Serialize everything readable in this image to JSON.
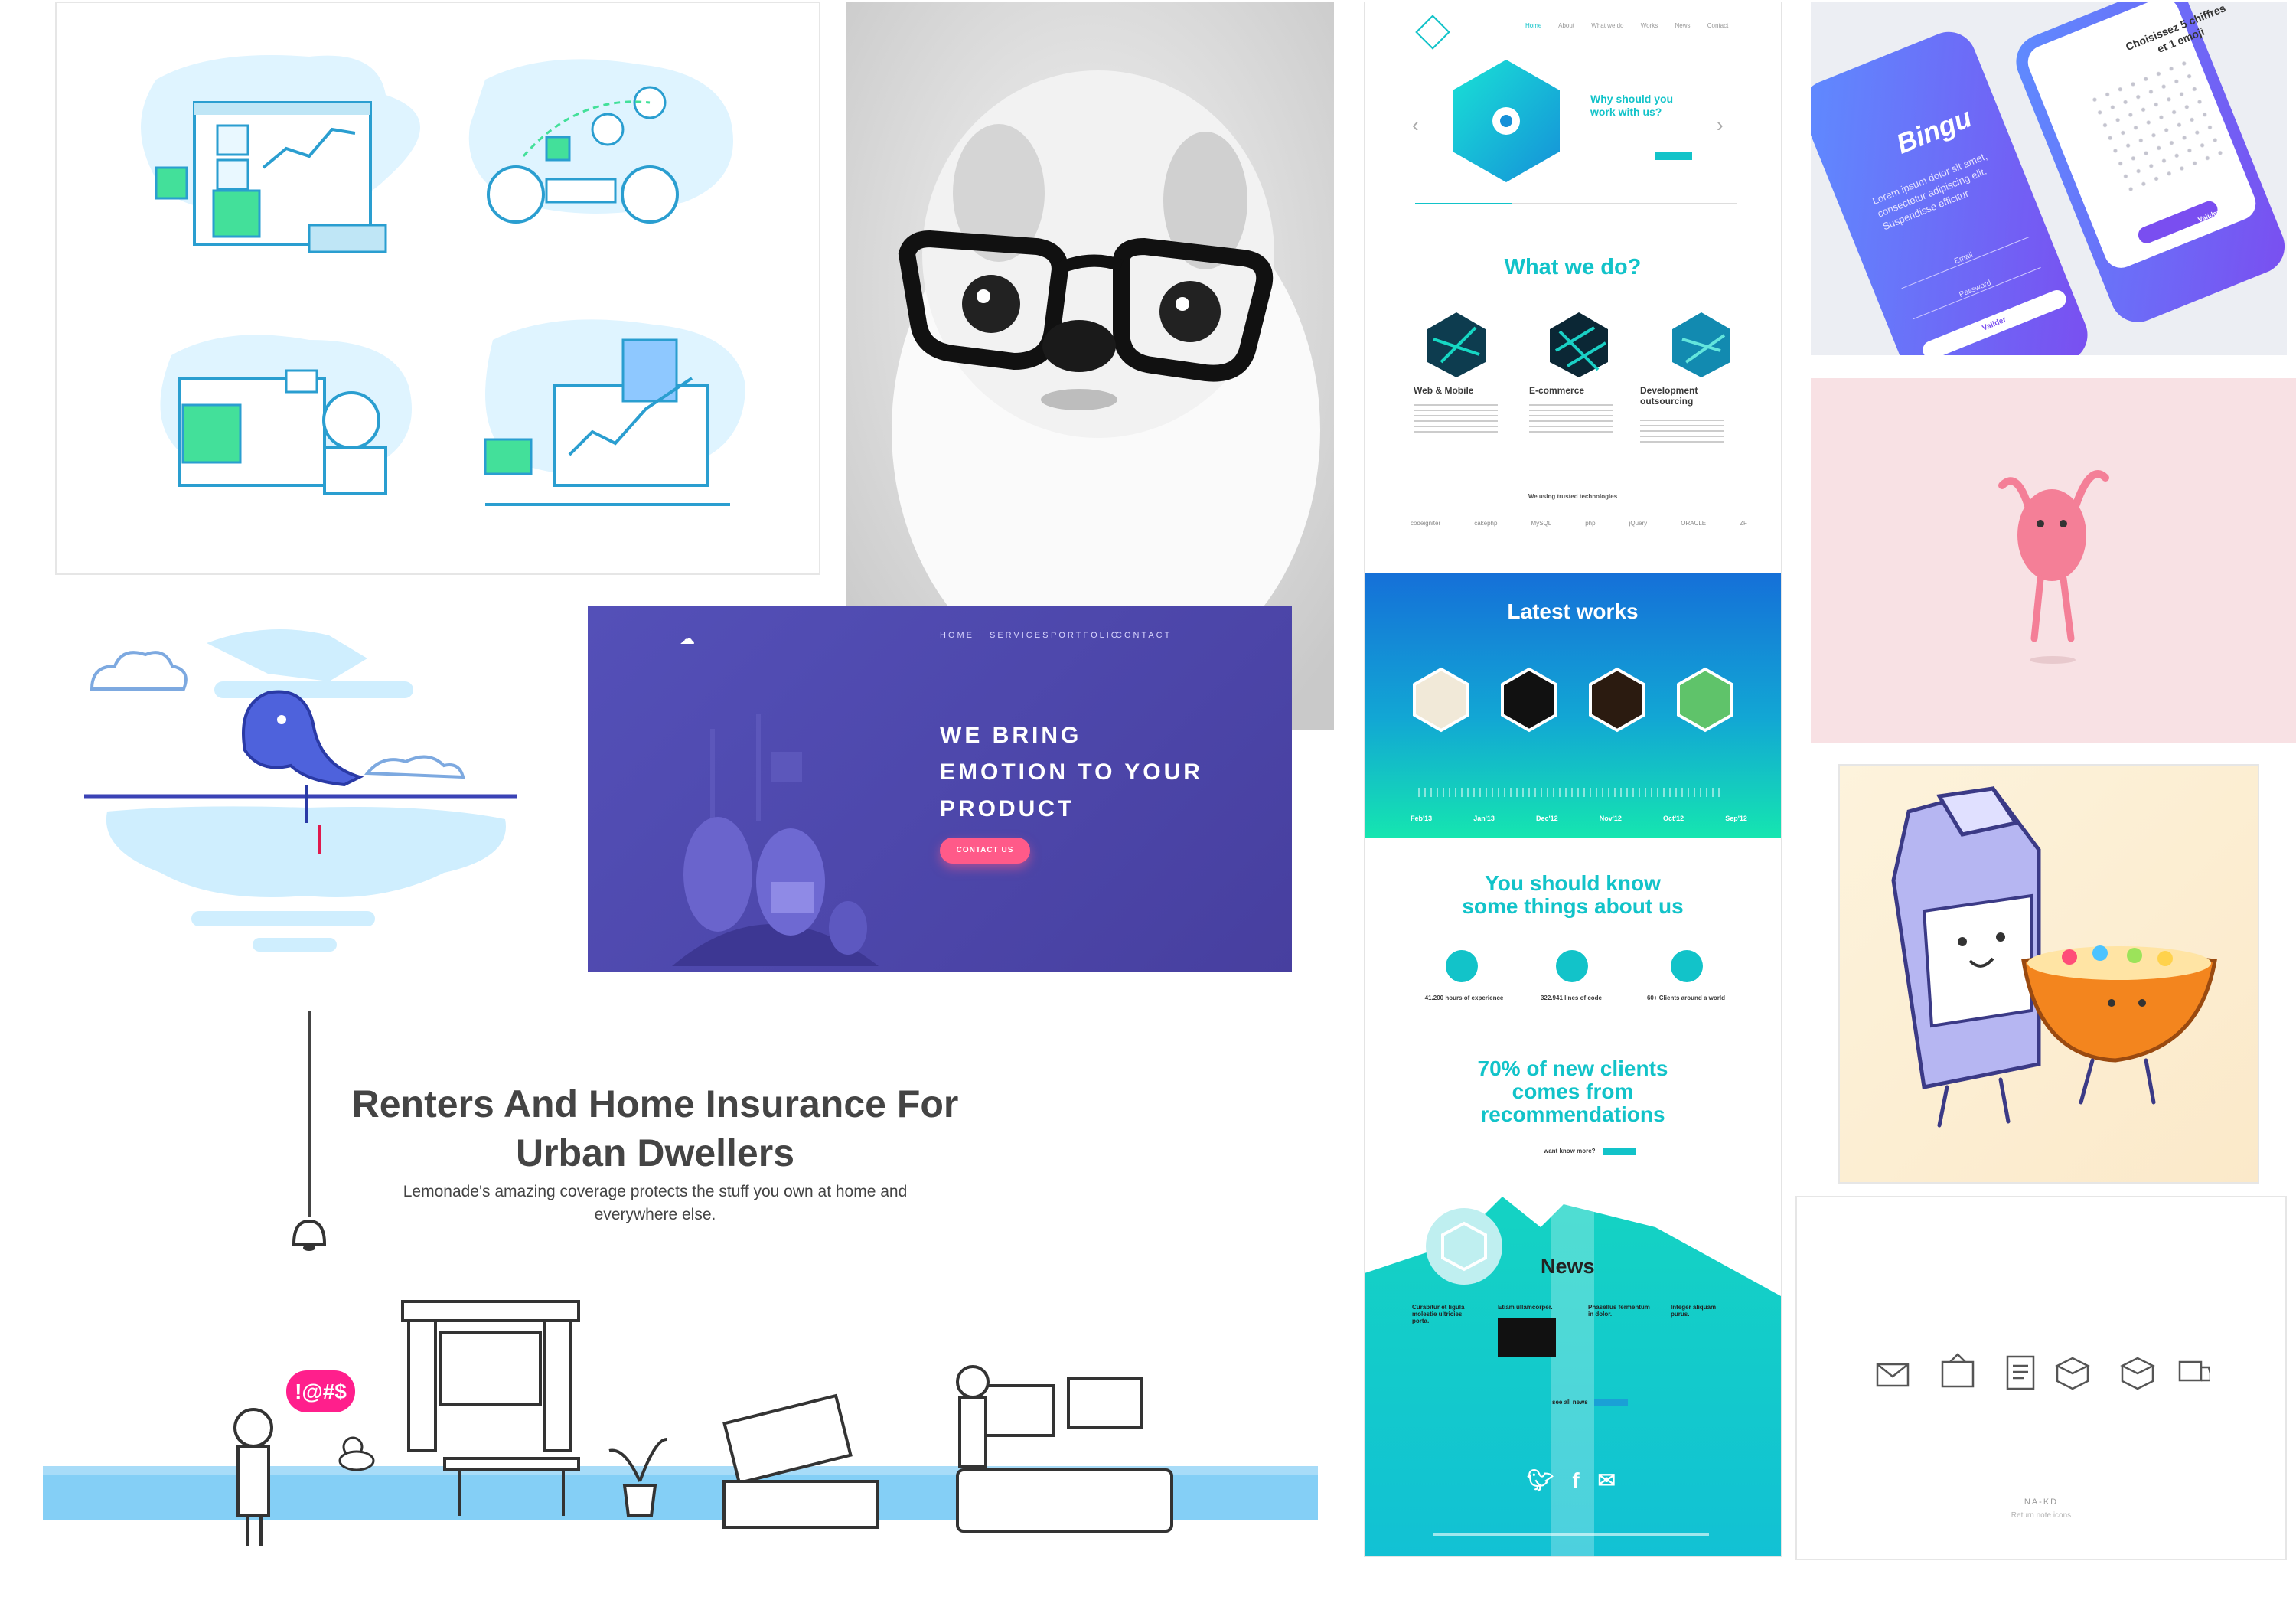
{
  "colors": {
    "teal": "#12c3c9",
    "purple_bg": "#4e4aa9",
    "pink": "#ff5a89",
    "light_blue": "#cfeefe",
    "insurance_blue": "#84cff6"
  },
  "icons": [
    "whale-illustration",
    "cloud-logo-icon",
    "lamp-icon",
    "duck-icon",
    "twitter-icon",
    "facebook-icon",
    "mail-icon",
    "return-note-icons"
  ],
  "purple_site": {
    "nav": [
      "HOME",
      "SERVICES",
      "PORTFOLIO",
      "CONTACT"
    ],
    "headline": [
      "WE BRING",
      "EMOTION TO YOUR",
      "PRODUCT"
    ],
    "cta": "CONTACT US"
  },
  "insurance": {
    "title_line1": "Renters And Home Insurance For",
    "title_line2": "Urban Dwellers",
    "subtitle_line1": "Lemonade's amazing coverage protects the stuff you own at home and",
    "subtitle_line2": "everywhere else.",
    "speech": "!@#$"
  },
  "teal_site": {
    "nav": [
      "Home",
      "About",
      "What we do",
      "Works",
      "News",
      "Contact"
    ],
    "hero_title_line1": "Why should you",
    "hero_title_line2": "work with us?",
    "what_we_do": "What we do?",
    "services": [
      "Web & Mobile",
      "E-commerce",
      "Development outsourcing"
    ],
    "tech_label": "We using trusted technologies",
    "tech": [
      "codeigniter",
      "cakephp",
      "MySQL",
      "php",
      "jQuery",
      "ORACLE",
      "ZF"
    ],
    "latest_works": "Latest works",
    "timeline": [
      "Feb'13",
      "Jan'13",
      "Dec'12",
      "Nov'12",
      "Oct'12",
      "Sep'12"
    ],
    "know_line1": "You should know",
    "know_line2": "some things about us",
    "stats": [
      "41.200 hours of experience",
      "322.941 lines of code",
      "60+ Clients around a world"
    ],
    "clients_line1": "70% of new clients",
    "clients_line2": "comes from",
    "clients_line3": "recommendations",
    "want_more": "want know more?",
    "news": "News",
    "news_items": [
      "Curabitur et ligula molestie ultricies porta.",
      "Etiam ullamcorper.",
      "Phasellus fermentum in dolor.",
      "Integer aliquam purus."
    ],
    "see_all": "see all news"
  },
  "bingu": {
    "app_name": "Bingu",
    "title_line1": "Choisissez 5 chiffres",
    "title_line2": "et 1 emoji",
    "body": "Lorem ipsum dolor sit amet, consectetur adipiscing elit. Suspendisse efficitur",
    "email": "Email",
    "password": "Password",
    "button": "Valider",
    "valider": "Valider"
  },
  "icons_tile": {
    "brand": "NA-KD",
    "caption": "Return note icons"
  }
}
